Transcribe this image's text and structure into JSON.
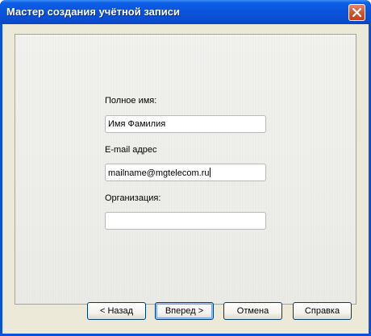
{
  "window": {
    "title": "Мастер создания учётной записи"
  },
  "form": {
    "full_name": {
      "label": "Полное имя:",
      "value": "Имя Фамилия"
    },
    "email": {
      "label": "E-mail адрес",
      "value": "mailname@mgtelecom.ru"
    },
    "organization": {
      "label": "Организация:",
      "value": ""
    }
  },
  "buttons": {
    "back": "< Назад",
    "next": "Вперед >",
    "cancel": "Отмена",
    "help": "Справка"
  },
  "colors": {
    "titlebar": "#0a55dd",
    "close_button": "#d6532f",
    "window_bg": "#ece9d8"
  },
  "icons": {
    "close": "close-icon"
  }
}
